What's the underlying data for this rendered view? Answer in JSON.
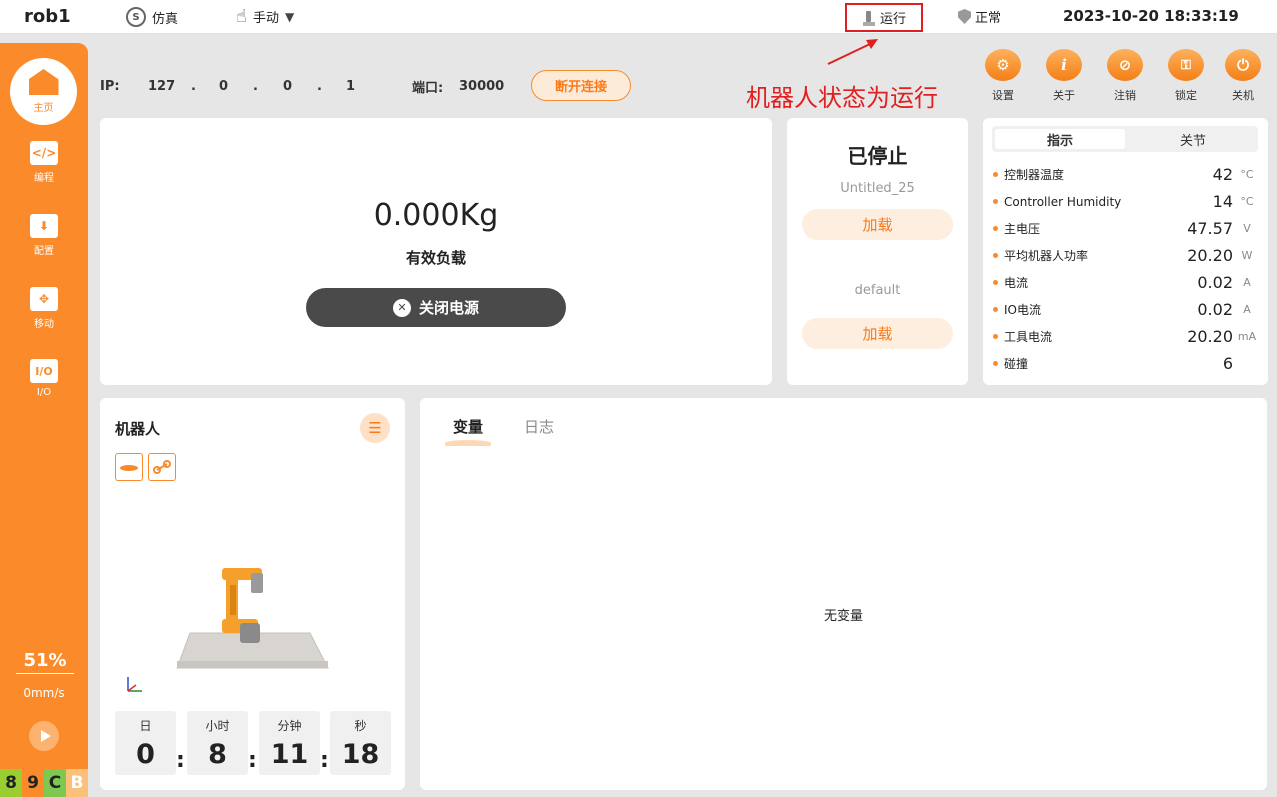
{
  "topbar": {
    "robot_name": "rob1",
    "sim_icon_glyph": "S",
    "sim_label": "仿真",
    "manual_label": "手动",
    "run_label": "运行",
    "normal_label": "正常",
    "datetime": "2023-10-20 18:33:19"
  },
  "sidebar": {
    "items": [
      {
        "label": "主页",
        "icon": "home-icon",
        "active": true
      },
      {
        "label": "编程",
        "icon": "code-icon",
        "glyph": "</>"
      },
      {
        "label": "配置",
        "icon": "config-icon",
        "glyph": "⬇"
      },
      {
        "label": "移动",
        "icon": "move-icon",
        "glyph": "✥"
      },
      {
        "label": "I/O",
        "icon": "io-icon",
        "glyph": "I/O"
      }
    ],
    "speed_percent": "51%",
    "speed_mms": "0mm/s",
    "chips": [
      {
        "text": "8",
        "color": "#9acd32"
      },
      {
        "text": "9",
        "color": "#fb8a2a"
      },
      {
        "text": "C",
        "color": "#7ec850"
      },
      {
        "text": "B",
        "color": "#fbc07a"
      }
    ]
  },
  "connection": {
    "ip_label": "IP:",
    "ip_parts": [
      "127",
      ".",
      "0",
      ".",
      "0",
      ".",
      "1"
    ],
    "port_label": "端口:",
    "port_value": "30000",
    "disconnect_label": "断开连接"
  },
  "annotation": "机器人状态为运行",
  "toolbar": [
    {
      "label": "设置",
      "icon": "gear-icon",
      "glyph": "⚙"
    },
    {
      "label": "关于",
      "icon": "info-icon",
      "glyph": "i"
    },
    {
      "label": "注销",
      "icon": "logout-icon",
      "glyph": "⊘"
    },
    {
      "label": "锁定",
      "icon": "lock-icon",
      "glyph": "🔒"
    },
    {
      "label": "关机",
      "icon": "power-icon",
      "glyph": "⏻"
    }
  ],
  "payload": {
    "value": "0.000Kg",
    "label": "有效负载",
    "power_button": "关闭电源"
  },
  "program": {
    "status": "已停止",
    "name": "Untitled_25",
    "load_label": "加载",
    "config_name": "default",
    "load_label_2": "加载"
  },
  "indicators": {
    "tabs": [
      "指示",
      "关节"
    ],
    "rows": [
      {
        "name": "控制器温度",
        "value": "42",
        "unit": "°C"
      },
      {
        "name": "Controller Humidity",
        "value": "14",
        "unit": "°C"
      },
      {
        "name": "主电压",
        "value": "47.57",
        "unit": "V"
      },
      {
        "name": "平均机器人功率",
        "value": "20.20",
        "unit": "W"
      },
      {
        "name": "电流",
        "value": "0.02",
        "unit": "A"
      },
      {
        "name": "IO电流",
        "value": "0.02",
        "unit": "A"
      },
      {
        "name": "工具电流",
        "value": "20.20",
        "unit": "mA"
      },
      {
        "name": "碰撞",
        "value": "6",
        "unit": ""
      }
    ]
  },
  "robot_panel": {
    "title": "机器人",
    "runtime": [
      {
        "label": "日",
        "value": "0"
      },
      {
        "label": "小时",
        "value": "8"
      },
      {
        "label": "分钟",
        "value": "11"
      },
      {
        "label": "秒",
        "value": "18"
      }
    ],
    "separator": ":"
  },
  "variables": {
    "tabs": [
      "变量",
      "日志"
    ],
    "empty_message": "无变量"
  }
}
